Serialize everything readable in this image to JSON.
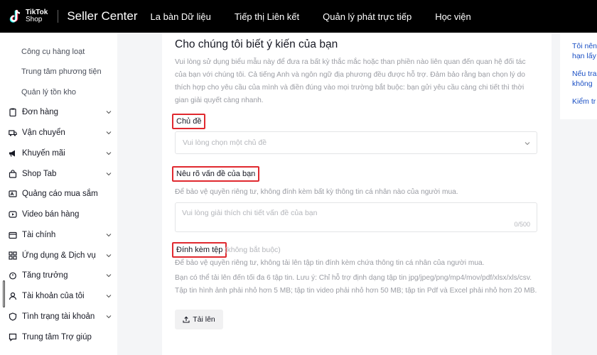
{
  "header": {
    "logo_line1": "TikTok",
    "logo_line2": "Shop",
    "brand": "Seller Center",
    "nav": [
      "La bàn Dữ liệu",
      "Tiếp thị Liên kết",
      "Quản lý phát trực tiếp",
      "Học viện"
    ]
  },
  "sidebar": {
    "subitems": [
      "Công cụ hàng loạt",
      "Trung tâm phương tiện",
      "Quản lý tồn kho"
    ],
    "items": [
      {
        "label": "Đơn hàng",
        "icon": "clipboard-icon",
        "expandable": true
      },
      {
        "label": "Vận chuyển",
        "icon": "truck-icon",
        "expandable": true
      },
      {
        "label": "Khuyến mãi",
        "icon": "megaphone-icon",
        "expandable": true
      },
      {
        "label": "Shop Tab",
        "icon": "shop-bag-icon",
        "expandable": true
      },
      {
        "label": "Quảng cáo mua sắm",
        "icon": "ads-icon",
        "expandable": false
      },
      {
        "label": "Video bán hàng",
        "icon": "video-icon",
        "expandable": false
      },
      {
        "label": "Tài chính",
        "icon": "wallet-icon",
        "expandable": true
      },
      {
        "label": "Ứng dụng & Dịch vụ",
        "icon": "apps-icon",
        "expandable": true
      },
      {
        "label": "Tăng trưởng",
        "icon": "growth-icon",
        "expandable": true
      },
      {
        "label": "Tài khoản của tôi",
        "icon": "user-icon",
        "expandable": true
      },
      {
        "label": "Tình trạng tài khoản",
        "icon": "shield-icon",
        "expandable": true
      },
      {
        "label": "Trung tâm Trợ giúp",
        "icon": "help-icon",
        "expandable": false
      }
    ]
  },
  "form": {
    "title": "Cho chúng tôi biết ý kiến của bạn",
    "description": "Vui lòng sử dụng biểu mẫu này để đưa ra bất kỳ thắc mắc hoặc than phiền nào liên quan đến quan hệ đối tác của bạn với chúng tôi. Cả tiếng Anh và ngôn ngữ địa phương đều được hỗ trợ. Đảm bảo rằng bạn chọn lý do thích hợp cho yêu cầu của mình và điền đúng vào mọi trường bắt buộc: bạn gửi yêu cầu càng chi tiết thì thời gian giải quyết càng nhanh.",
    "topic_label": "Chủ đề",
    "topic_placeholder": "Vui lòng chọn một chủ đề",
    "issue_label": "Nêu rõ vấn đề của bạn",
    "issue_hint": "Để bảo vệ quyền riêng tư, không đính kèm bất kỳ thông tin cá nhân nào của người mua.",
    "issue_placeholder": "Vui lòng giải thích chi tiết vấn đề của bạn",
    "issue_counter": "0/500",
    "attach_label": "Đính kèm tệp",
    "attach_optional": "(không bắt buộc)",
    "attach_hint": "Để bảo vệ quyền riêng tư, không tải lên tập tin đính kèm chứa thông tin cá nhân của người mua.",
    "attach_note": "Bạn có thể tải lên đến tối đa 6 tập tin. Lưu ý: Chỉ hỗ trợ định dạng tập tin jpg/jpeg/png/mp4/mov/pdf/xlsx/xls/csv. Tập tin hình ảnh phải nhỏ hơn 5 MB; tập tin video phải nhỏ hơn 50 MB; tập tin Pdf và Excel phải nhỏ hơn 20 MB.",
    "upload_button": "Tải lên"
  },
  "right_panel": {
    "links": [
      "Tôi nên",
      "hạn lấy",
      "Nếu tra",
      "không",
      "Kiểm tr"
    ]
  },
  "colors": {
    "header_bg": "#000000",
    "highlight_border": "#e0292f",
    "link": "#1a4fc4"
  }
}
